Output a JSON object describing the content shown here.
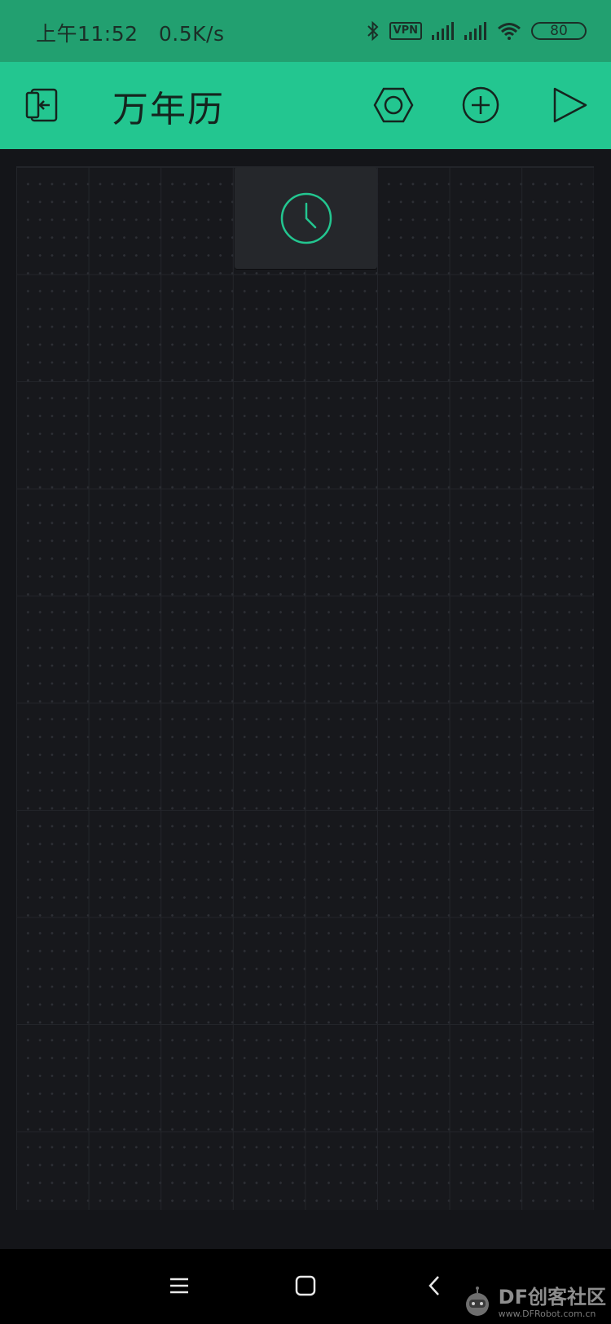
{
  "status_bar": {
    "time": "上午11:52",
    "net_speed": "0.5K/s",
    "vpn_label": "VPN",
    "battery_level": "80",
    "icons": [
      "bluetooth-icon",
      "vpn-icon",
      "signal-icon",
      "signal-icon",
      "wifi-icon",
      "battery-icon"
    ]
  },
  "app_bar": {
    "title": "万年历",
    "icons": {
      "back": "exit-project-icon",
      "settings": "hexagon-settings-icon",
      "add": "add-circle-icon",
      "play": "play-icon"
    }
  },
  "canvas": {
    "widgets": [
      {
        "type": "rtc-clock",
        "icon": "clock-icon"
      }
    ]
  },
  "nav_bar": {
    "icons": [
      "menu-icon",
      "home-square-icon",
      "back-chevron-icon"
    ]
  },
  "watermark": {
    "brand": "DF创客社区",
    "url": "www.DFRobot.com.cn"
  },
  "colors": {
    "status_bar_bg": "#22a070",
    "app_bar_bg": "#23c690",
    "canvas_bg": "#17181c",
    "widget_bg": "#25272b",
    "accent": "#23c690"
  }
}
